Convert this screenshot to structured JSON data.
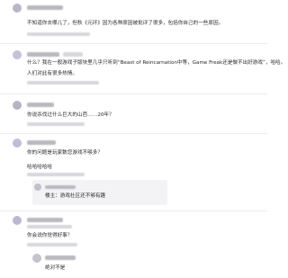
{
  "comments": [
    {
      "text": "不知道你去哪儿了，但秋《元环》因为各种原因被批评了很多，包括你自己的一些原因。"
    },
    {
      "text": "什么？我在一般游戏子版块里几乎只听到“Beast of Reincarnation中等，Game Freak还是做不出好游戏”，哈哈。",
      "text2": "人们对此有很多热情。"
    },
    {
      "text": "你说杀伐过什么巨大的山芭……20年？"
    },
    {
      "text": "你的问题是玩家数您游戏不够多？",
      "text2": "哈哈哈哈哈"
    },
    {
      "text": "楼主：游戏社区还不够有趣"
    },
    {
      "text": "你会说你觉得好事？"
    },
    {
      "text": "绝对不是"
    }
  ],
  "icons": [
    "more-icon",
    "reply-icon",
    "upvote-icon",
    "downvote-icon"
  ]
}
